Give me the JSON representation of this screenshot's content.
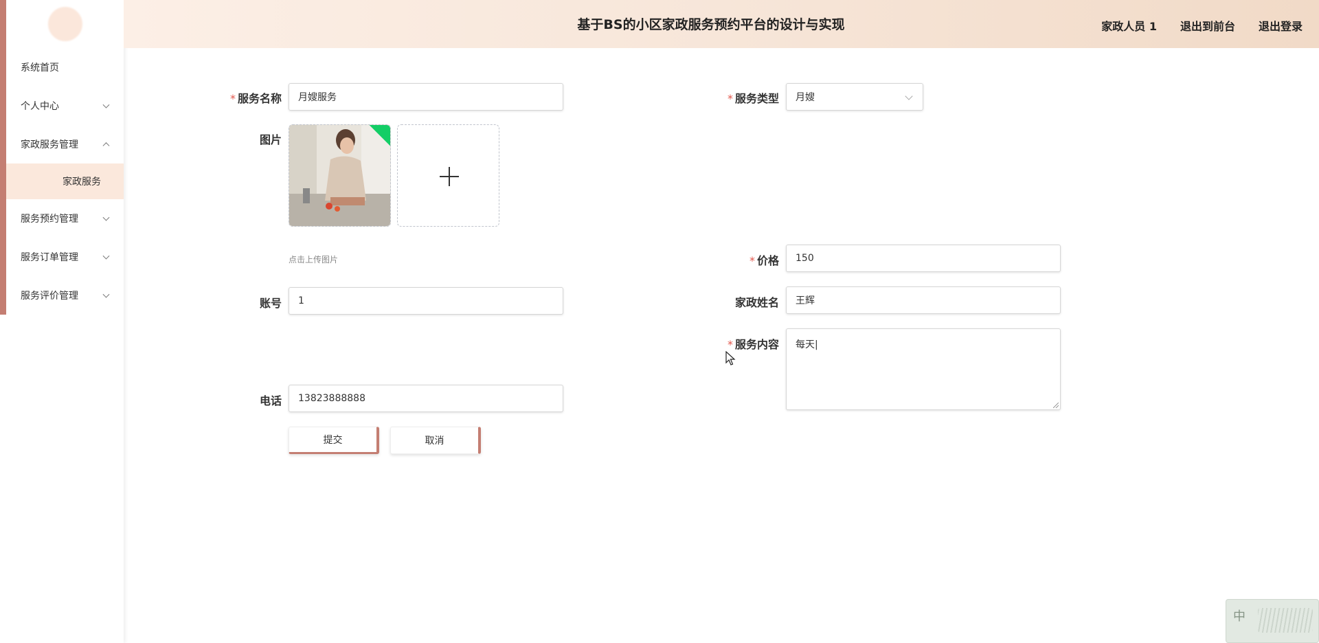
{
  "header": {
    "title": "基于BS的小区家政服务预约平台的设计与实现",
    "user": "家政人员 1",
    "to_frontend": "退出到前台",
    "logout": "退出登录"
  },
  "sidebar": {
    "items": [
      {
        "label": "系统首页"
      },
      {
        "label": "个人中心"
      },
      {
        "label": "家政服务管理"
      },
      {
        "label": "家政服务"
      },
      {
        "label": "服务预约管理"
      },
      {
        "label": "服务订单管理"
      },
      {
        "label": "服务评价管理"
      }
    ]
  },
  "form": {
    "service_name": {
      "label": "服务名称",
      "value": "月嫂服务"
    },
    "service_type": {
      "label": "服务类型",
      "value": "月嫂"
    },
    "image": {
      "label": "图片",
      "hint": "点击上传图片"
    },
    "price": {
      "label": "价格",
      "value": "150"
    },
    "account": {
      "label": "账号",
      "value": "1"
    },
    "housekeeper_name": {
      "label": "家政姓名",
      "value": "王辉"
    },
    "service_content": {
      "label": "服务内容",
      "value": "每天|"
    },
    "phone": {
      "label": "电话",
      "value": "13823888888"
    },
    "submit_label": "提交",
    "cancel_label": "取消",
    "required_mark": "*"
  },
  "ime": {
    "label": "中"
  },
  "colors": {
    "accent": "#c47e72",
    "required": "#e2574c",
    "upload_tag": "#13ce66",
    "active_menu_bg": "#fbe8dc"
  }
}
